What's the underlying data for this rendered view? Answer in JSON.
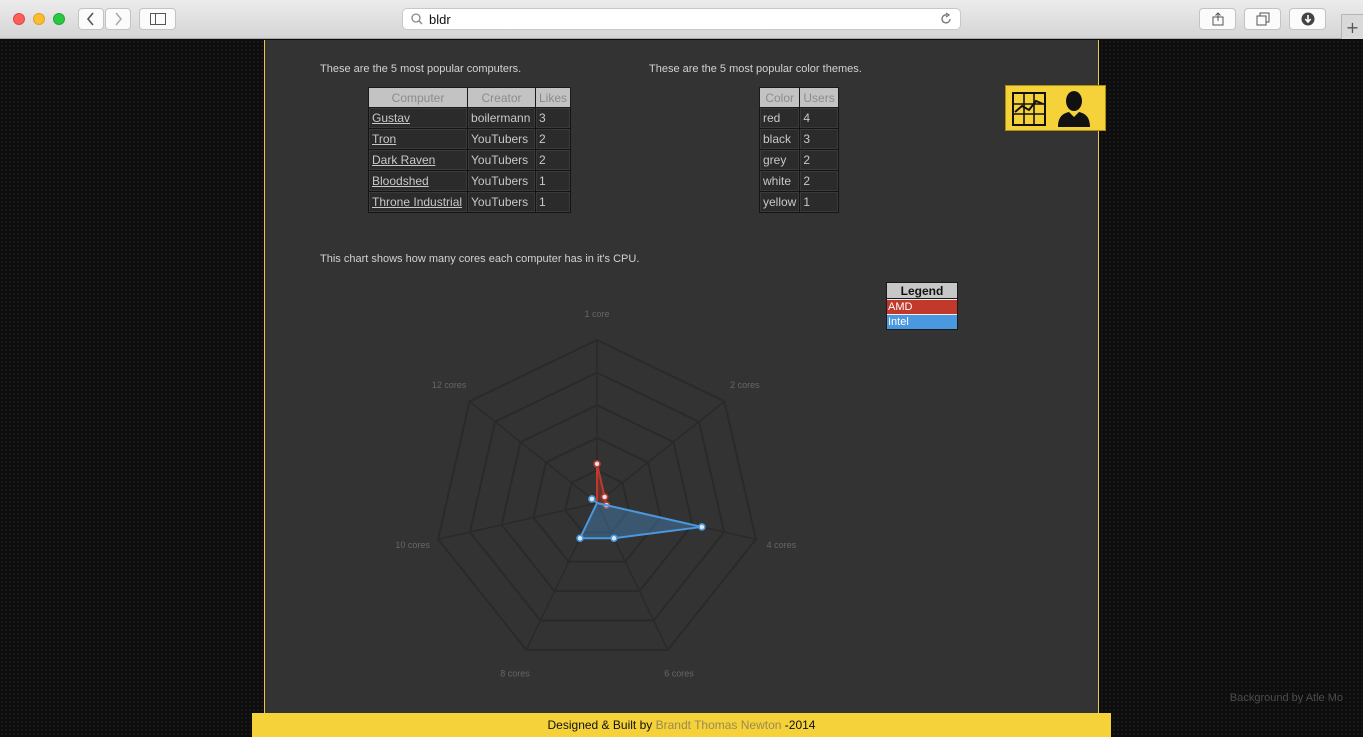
{
  "browser": {
    "url": "bldr"
  },
  "tables": {
    "computers": {
      "caption": "These are the 5 most popular computers.",
      "headers": [
        "Computer",
        "Creator",
        "Likes"
      ],
      "rows": [
        [
          "Gustav",
          "boilermann",
          "3"
        ],
        [
          "Tron",
          "YouTubers",
          "2"
        ],
        [
          "Dark Raven",
          "YouTubers",
          "2"
        ],
        [
          "Bloodshed",
          "YouTubers",
          "1"
        ],
        [
          "Throne Industrial",
          "YouTubers",
          "1"
        ]
      ]
    },
    "themes": {
      "caption": "These are the 5 most popular color themes.",
      "headers": [
        "Color",
        "Users"
      ],
      "rows": [
        [
          "red",
          "4"
        ],
        [
          "black",
          "3"
        ],
        [
          "grey",
          "2"
        ],
        [
          "white",
          "2"
        ],
        [
          "yellow",
          "1"
        ]
      ]
    }
  },
  "icons": {
    "chart": "line-chart-icon",
    "user": "user-icon"
  },
  "chart": {
    "caption": "This chart shows how many cores each computer has in it's CPU."
  },
  "chart_data": {
    "type": "radar",
    "categories": [
      "1 core",
      "2 cores",
      "4 cores",
      "6 cores",
      "8 cores",
      "10 cores",
      "12 cores"
    ],
    "rmax": 5,
    "series": [
      {
        "name": "AMD",
        "color": "#c0392b",
        "values": [
          1.2,
          0.3,
          0.3,
          0,
          0,
          0,
          0
        ]
      },
      {
        "name": "Intel",
        "color": "#4a98e0",
        "values": [
          0,
          0,
          3.3,
          1.2,
          1.2,
          0,
          0.2
        ]
      }
    ],
    "legend": {
      "title": "Legend",
      "placement": "right"
    }
  },
  "colors": {
    "accent_yellow": "#f5d23a",
    "amd": "#c0392b",
    "intel": "#4a98e0"
  },
  "footer": {
    "prefix": "Designed & Built by",
    "author": "Brandt Thomas Newton",
    "suffix": "-2014",
    "credit": "Background by Atle Mo"
  }
}
